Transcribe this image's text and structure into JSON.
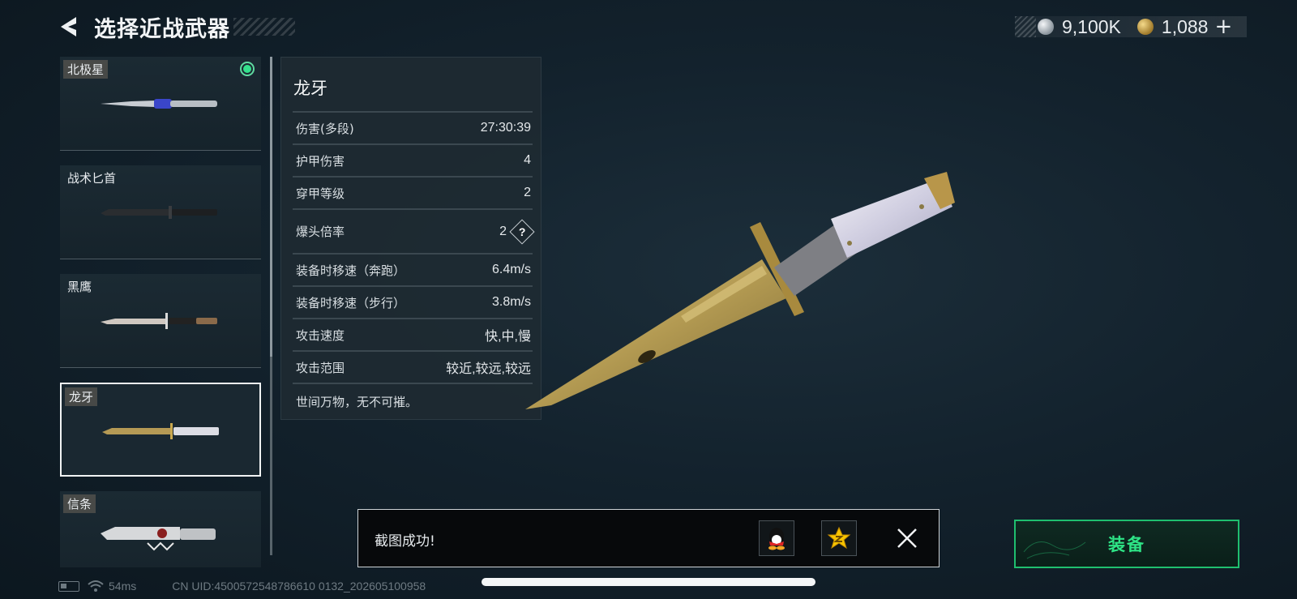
{
  "header": {
    "title": "选择近战武器",
    "back_icon": "back-arrow-icon"
  },
  "currency": {
    "silver_amount": "9,100K",
    "gold_amount": "1,088",
    "plus_label": "+"
  },
  "weapons": [
    {
      "name": "北极星",
      "equipped": true,
      "selected": false
    },
    {
      "name": "战术匕首",
      "equipped": false,
      "selected": false
    },
    {
      "name": "黑鹰",
      "equipped": false,
      "selected": false
    },
    {
      "name": "龙牙",
      "equipped": false,
      "selected": true
    },
    {
      "name": "信条",
      "equipped": false,
      "selected": false
    }
  ],
  "stats_panel": {
    "title": "龙牙",
    "rows": [
      {
        "label": "伤害(多段)",
        "value": "27:30:39"
      },
      {
        "label": "护甲伤害",
        "value": "4"
      },
      {
        "label": "穿甲等级",
        "value": "2"
      },
      {
        "label": "爆头倍率",
        "value": "2",
        "help": "?"
      },
      {
        "label": "装备时移速（奔跑）",
        "value": "6.4m/s"
      },
      {
        "label": "装备时移速（步行）",
        "value": "3.8m/s"
      },
      {
        "label": "攻击速度",
        "value": "快,中,慢"
      },
      {
        "label": "攻击范围",
        "value": "较近,较远,较远"
      }
    ],
    "description": "世间万物，无不可摧。"
  },
  "toast": {
    "message": "截图成功!",
    "share_icons": [
      "qq-icon",
      "qzone-icon"
    ]
  },
  "equip_button": {
    "label": "装备"
  },
  "status_bar": {
    "ping": "54ms",
    "uid": "CN UID:4500572548786610 0132_202605100958"
  },
  "colors": {
    "accent_green": "#2ee486",
    "equipped_dot": "#34e08c",
    "background": "#13222d"
  }
}
